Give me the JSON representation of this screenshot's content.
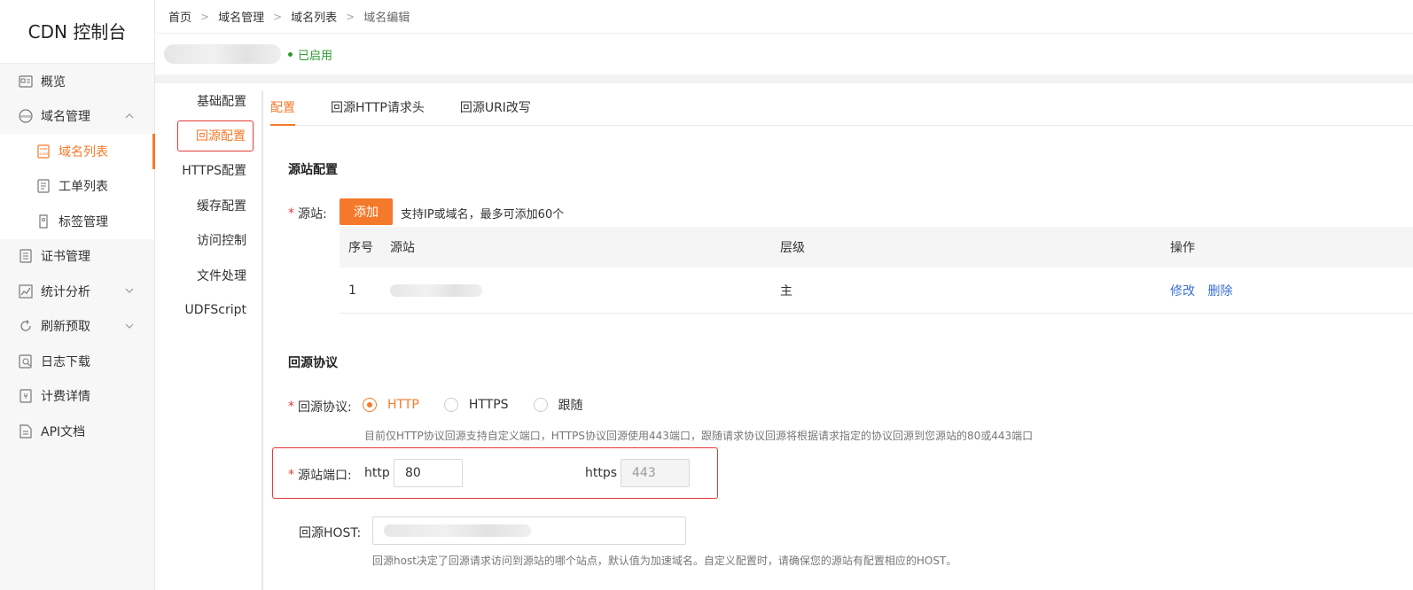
{
  "app": {
    "title": "CDN 控制台"
  },
  "sidebar": {
    "items": [
      {
        "label": "概览",
        "icon": "overview-icon"
      },
      {
        "label": "域名管理",
        "icon": "www-icon",
        "expanded": true
      },
      {
        "label": "域名列表",
        "icon": "domain-list-icon",
        "sub": true,
        "active": true
      },
      {
        "label": "工单列表",
        "icon": "document-icon",
        "sub": true
      },
      {
        "label": "标签管理",
        "icon": "tag-icon",
        "sub": true
      },
      {
        "label": "证书管理",
        "icon": "certificate-icon"
      },
      {
        "label": "统计分析",
        "icon": "chart-icon",
        "collapsible": true
      },
      {
        "label": "刷新预取",
        "icon": "refresh-icon",
        "collapsible": true
      },
      {
        "label": "日志下载",
        "icon": "log-icon"
      },
      {
        "label": "计费详情",
        "icon": "billing-icon"
      },
      {
        "label": "API文档",
        "icon": "api-doc-icon"
      }
    ]
  },
  "breadcrumb": [
    "首页",
    "域名管理",
    "域名列表",
    "域名编辑"
  ],
  "domain": {
    "status": "已启用"
  },
  "subnav": {
    "items": [
      "基础配置",
      "回源配置",
      "HTTPS配置",
      "缓存配置",
      "访问控制",
      "文件处理",
      "UDFScript"
    ],
    "active_index": 1
  },
  "tabs": {
    "items": [
      "配置",
      "回源HTTP请求头",
      "回源URI改写"
    ],
    "active_index": 0
  },
  "origin": {
    "section_title": "源站配置",
    "label": "源站:",
    "add_button": "添加",
    "hint": "支持IP或域名，最多可添加60个",
    "table": {
      "headers": [
        "序号",
        "源站",
        "层级",
        "操作"
      ],
      "rows": [
        {
          "index": "1",
          "level": "主",
          "actions": [
            "修改",
            "删除"
          ]
        }
      ]
    }
  },
  "protocol": {
    "section_title": "回源协议",
    "label": "回源协议:",
    "options": [
      "HTTP",
      "HTTPS",
      "跟随"
    ],
    "selected": "HTTP",
    "note": "目前仅HTTP协议回源支持自定义端口，HTTPS协议回源使用443端口，跟随请求协议回源将根据请求指定的协议回源到您源站的80或443端口"
  },
  "port": {
    "label": "源站端口:",
    "http_label": "http",
    "http_value": "80",
    "https_label": "https",
    "https_value": "443"
  },
  "host": {
    "label": "回源HOST:",
    "note": "回源host决定了回源请求访问到源站的哪个站点，默认值为加速域名。自定义配置时，请确保您的源站有配置相应的HOST。"
  },
  "colors": {
    "accent": "#f5792a",
    "status_ok": "#2d9c2d",
    "link": "#3a6fd8",
    "required": "#e53935"
  }
}
